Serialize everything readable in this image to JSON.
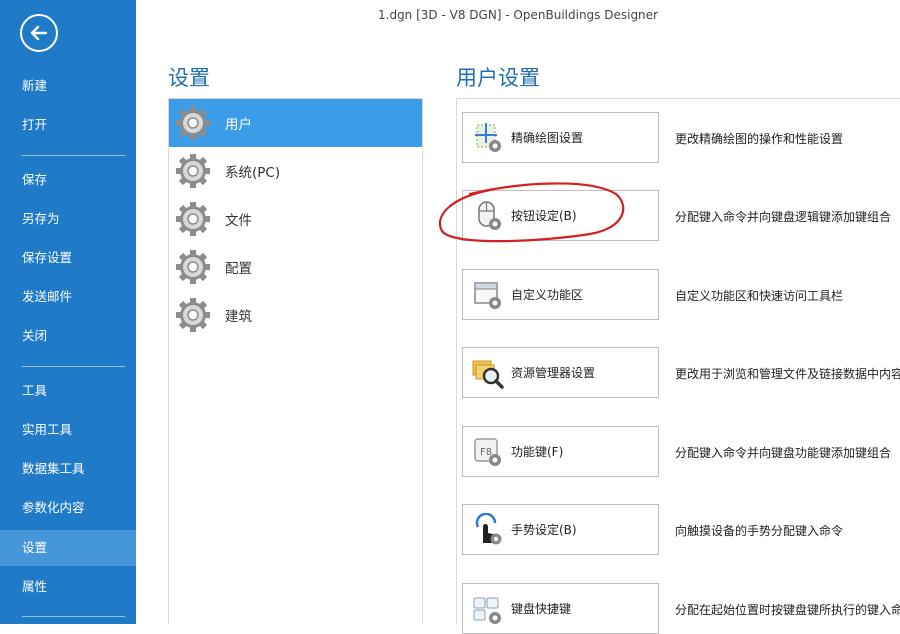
{
  "window": {
    "title": "1.dgn [3D - V8 DGN] - OpenBuildings Designer"
  },
  "sidebar": {
    "items": [
      {
        "label": "新建",
        "active": false
      },
      {
        "label": "打开",
        "active": false
      },
      {
        "label": "保存",
        "active": false
      },
      {
        "label": "另存为",
        "active": false
      },
      {
        "label": "保存设置",
        "active": false
      },
      {
        "label": "发送邮件",
        "active": false
      },
      {
        "label": "关闭",
        "active": false
      },
      {
        "label": "工具",
        "active": false
      },
      {
        "label": "实用工具",
        "active": false
      },
      {
        "label": "数据集工具",
        "active": false
      },
      {
        "label": "参数化内容",
        "active": false
      },
      {
        "label": "设置",
        "active": true
      },
      {
        "label": "属性",
        "active": false
      }
    ]
  },
  "settings": {
    "title": "设置",
    "categories": [
      {
        "label": "用户",
        "selected": true
      },
      {
        "label": "系统(PC)",
        "selected": false
      },
      {
        "label": "文件",
        "selected": false
      },
      {
        "label": "配置",
        "selected": false
      },
      {
        "label": "建筑",
        "selected": false
      }
    ]
  },
  "user_settings": {
    "title": "用户设置",
    "items": [
      {
        "label": "精确绘图设置",
        "icon": "accudraw-settings-icon",
        "description": "更改精确绘图的操作和性能设置"
      },
      {
        "label": "按钮设定(B)",
        "icon": "mouse-button-icon",
        "description": "分配键入命令并向键盘逻辑键添加键组合"
      },
      {
        "label": "自定义功能区",
        "icon": "customize-ribbon-icon",
        "description": "自定义功能区和快速访问工具栏"
      },
      {
        "label": "资源管理器设置",
        "icon": "explorer-settings-icon",
        "description": "更改用于浏览和管理文件及链接数据中内容"
      },
      {
        "label": "功能键(F)",
        "icon": "function-keys-icon",
        "description": "分配键入命令并向键盘功能键添加键组合"
      },
      {
        "label": "手势设定(B)",
        "icon": "gesture-icon",
        "description": "向触摸设备的手势分配键入命令"
      },
      {
        "label": "键盘快捷键",
        "icon": "keyboard-shortcut-icon",
        "description": "分配在起始位置时按键盘键所执行的键入命令"
      }
    ]
  },
  "colors": {
    "sidebar": "#1f7bc7",
    "sidebar_active": "#4597d9",
    "selected_category": "#3b9de8",
    "heading": "#1f6fb5",
    "annotation": "#d32020"
  }
}
